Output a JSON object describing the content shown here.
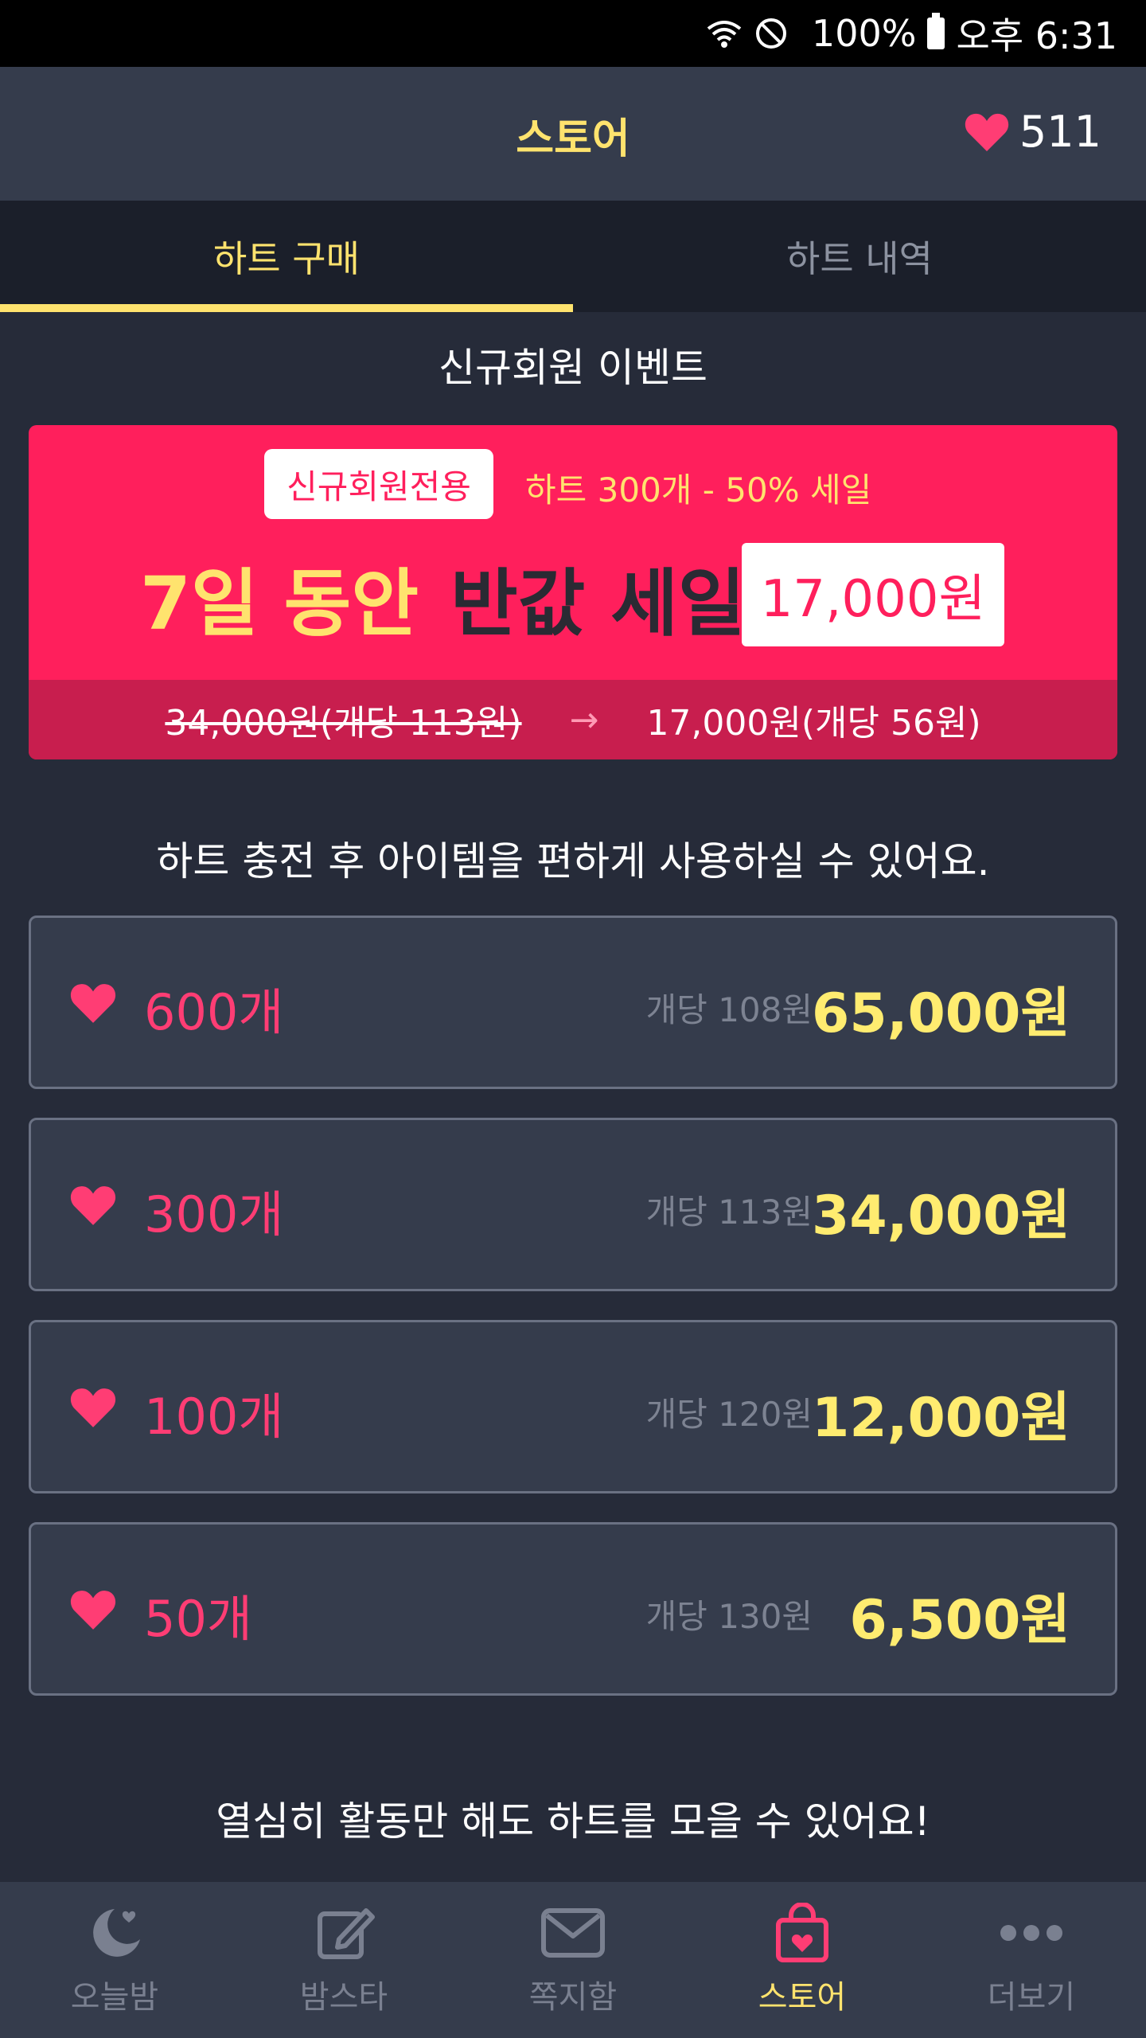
{
  "status_bar": {
    "battery": "100%",
    "time": "오후 6:31"
  },
  "header": {
    "title": "스토어",
    "heart_count": "511"
  },
  "tabs": [
    {
      "label": "하트 구매",
      "active": true
    },
    {
      "label": "하트 내역",
      "active": false
    }
  ],
  "event": {
    "section_title": "신규회원 이벤트",
    "badge": "신규회원전용",
    "subtitle": "하트 300개 - 50% 세일",
    "headline_part1": "7일 동안",
    "headline_part2": "반값 세일",
    "price": "17,000원",
    "original": "34,000원(개당 113원)",
    "arrow": "→",
    "discounted": "17,000원(개당 56원)"
  },
  "info_text": "하트 충전 후 아이템을 편하게 사용하실 수 있어요.",
  "packages": [
    {
      "qty": "600개",
      "unit": "개당 108원",
      "price": "65,000원"
    },
    {
      "qty": "300개",
      "unit": "개당 113원",
      "price": "34,000원"
    },
    {
      "qty": "100개",
      "unit": "개당 120원",
      "price": "12,000원"
    },
    {
      "qty": "50개",
      "unit": "개당 130원",
      "price": "6,500원"
    }
  ],
  "footer_text": "열심히 활동만 해도 하트를 모을 수 있어요!",
  "bottom_nav": [
    {
      "label": "오늘밤",
      "icon": "moon-icon",
      "active": false
    },
    {
      "label": "밤스타",
      "icon": "edit-icon",
      "active": false
    },
    {
      "label": "쪽지함",
      "icon": "mail-icon",
      "active": false
    },
    {
      "label": "스토어",
      "icon": "shopping-bag-heart-icon",
      "active": true
    },
    {
      "label": "더보기",
      "icon": "more-dots-icon",
      "active": false
    }
  ],
  "colors": {
    "accent_yellow": "#ffe36e",
    "accent_pink": "#ff1f5c",
    "background": "#262b39"
  }
}
